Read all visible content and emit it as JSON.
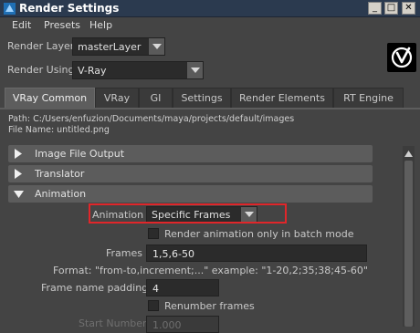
{
  "window": {
    "title": "Render Settings",
    "minimize": "_",
    "maximize": "□",
    "close": "✕"
  },
  "menu": {
    "items": [
      "Edit",
      "Presets",
      "Help"
    ]
  },
  "render_layer": {
    "label": "Render Layer",
    "value": "masterLayer"
  },
  "render_using": {
    "label": "Render Using",
    "value": "V-Ray"
  },
  "logo": {
    "icon": "vray-logo-icon"
  },
  "tabs": [
    "VRay Common",
    "VRay",
    "GI",
    "Settings",
    "Render Elements",
    "RT Engine"
  ],
  "active_tab": "VRay Common",
  "path": {
    "path_line": "Path: C:/Users/enfuzion/Documents/maya/projects/default/images",
    "file_line": "File Name: untitled.png"
  },
  "sections": {
    "image_file_output": "Image File Output",
    "translator": "Translator",
    "animation": "Animation"
  },
  "animation": {
    "mode_label": "Animation",
    "mode_value": "Specific Frames",
    "batch_checkbox_label": "Render animation only in batch mode",
    "batch_checked": false,
    "frames_label": "Frames",
    "frames_value": "1,5,6-50",
    "format_hint": "Format: \"from-to,increment;...\" example: \"1-20,2;35;38;45-60\"",
    "padding_label": "Frame name padding",
    "padding_value": "4",
    "renumber_label": "Renumber frames",
    "renumber_checked": false,
    "start_number_label": "Start Number",
    "start_number_value": "1.000"
  },
  "colors": {
    "highlight": "#e0262a",
    "titlebar": "#2b3a4f",
    "active_tab": "#5d5d5d"
  }
}
